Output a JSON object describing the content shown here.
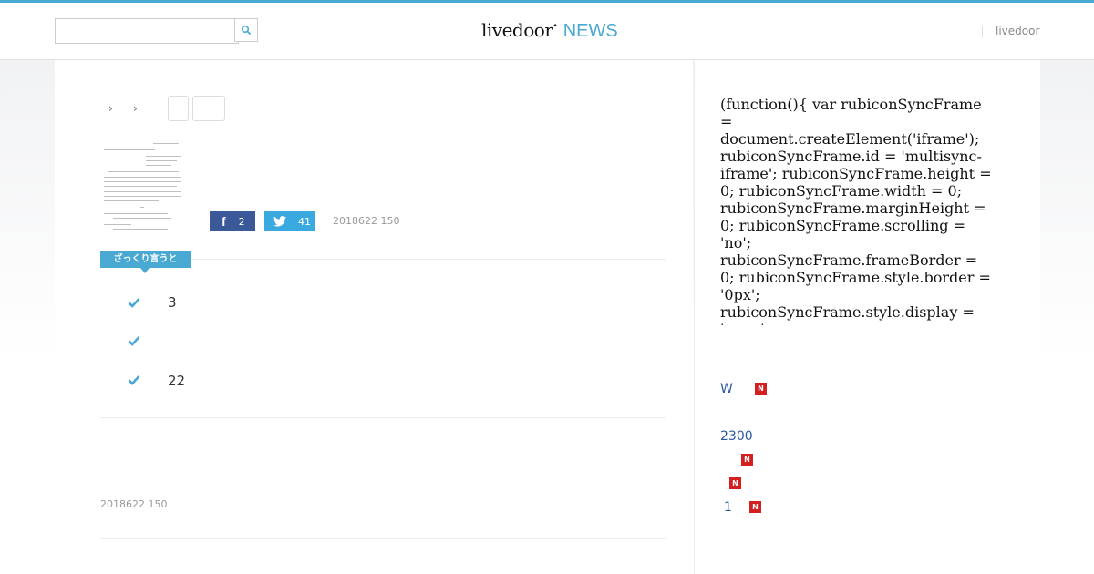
{
  "header": {
    "search_placeholder": "",
    "logo_primary": "livedoor",
    "logo_secondary": "NEWS",
    "right_link": "livedoor"
  },
  "breadcrumb": {
    "separator": "›"
  },
  "article": {
    "share": {
      "facebook_count": "2",
      "twitter_count": "41"
    },
    "date_top": "2018622 150",
    "summary_label": "ざっくり言うと",
    "points": [
      "3",
      "",
      "22"
    ],
    "date_bottom": "2018622 150"
  },
  "sidebar": {
    "code_text": "(function(){ var rubiconSyncFrame = document.createElement('iframe'); rubiconSyncFrame.id = 'multisync-iframe'; rubiconSyncFrame.height = 0; rubiconSyncFrame.width = 0; rubiconSyncFrame.marginHeight = 0; rubiconSyncFrame.scrolling = 'no'; rubiconSyncFrame.frameBorder = 0; rubiconSyncFrame.style.border = '0px'; rubiconSyncFrame.style.display = 'none';",
    "items": [
      {
        "label": "W",
        "badge": "N"
      },
      {
        "label": "2300",
        "badge": ""
      },
      {
        "label": "",
        "badge": "N"
      },
      {
        "label": "",
        "badge": "N"
      },
      {
        "label": "1",
        "badge": "N"
      }
    ]
  },
  "colors": {
    "accent": "#49a9d3",
    "facebook": "#3b5998",
    "twitter": "#3aa9e0",
    "new_badge": "#d31f1f",
    "link": "#2d5a9b"
  },
  "icons": [
    "search-icon",
    "facebook-icon",
    "twitter-icon",
    "checkmark-icon",
    "new-badge"
  ]
}
